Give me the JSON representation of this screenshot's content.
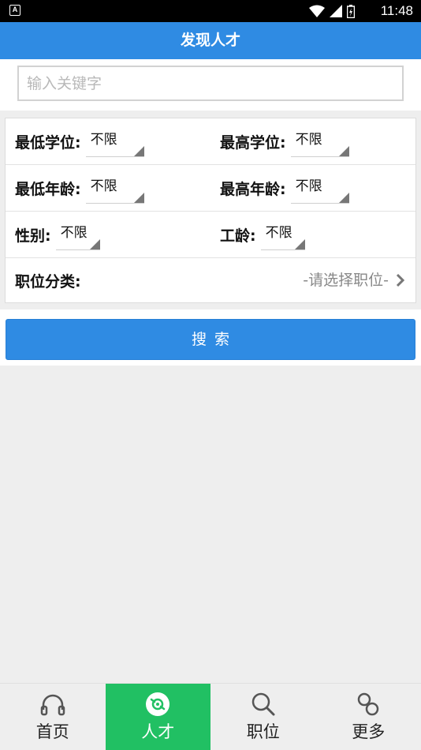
{
  "status_bar": {
    "notification_letter": "A",
    "time": "11:48"
  },
  "header": {
    "title": "发现人才"
  },
  "search": {
    "value": "",
    "placeholder": "输入关键字"
  },
  "filters": {
    "min_degree_label": "最低学位:",
    "min_degree_value": "不限",
    "max_degree_label": "最高学位:",
    "max_degree_value": "不限",
    "min_age_label": "最低年龄:",
    "min_age_value": "不限",
    "max_age_label": "最高年龄:",
    "max_age_value": "不限",
    "gender_label": "性别:",
    "gender_value": "不限",
    "seniority_label": "工龄:",
    "seniority_value": "不限",
    "category_label": "职位分类:",
    "category_placeholder": "-请选择职位-"
  },
  "search_button": {
    "label": "搜索"
  },
  "bottom_nav": {
    "items": [
      {
        "label": "首页",
        "icon": "headphones-icon",
        "active": false
      },
      {
        "label": "人才",
        "icon": "talent-icon",
        "active": true
      },
      {
        "label": "职位",
        "icon": "search-icon",
        "active": false
      },
      {
        "label": "更多",
        "icon": "link-icon",
        "active": false
      }
    ]
  },
  "colors": {
    "primary": "#2f8be3",
    "nav_active": "#21c063",
    "background": "#eeeeee"
  }
}
